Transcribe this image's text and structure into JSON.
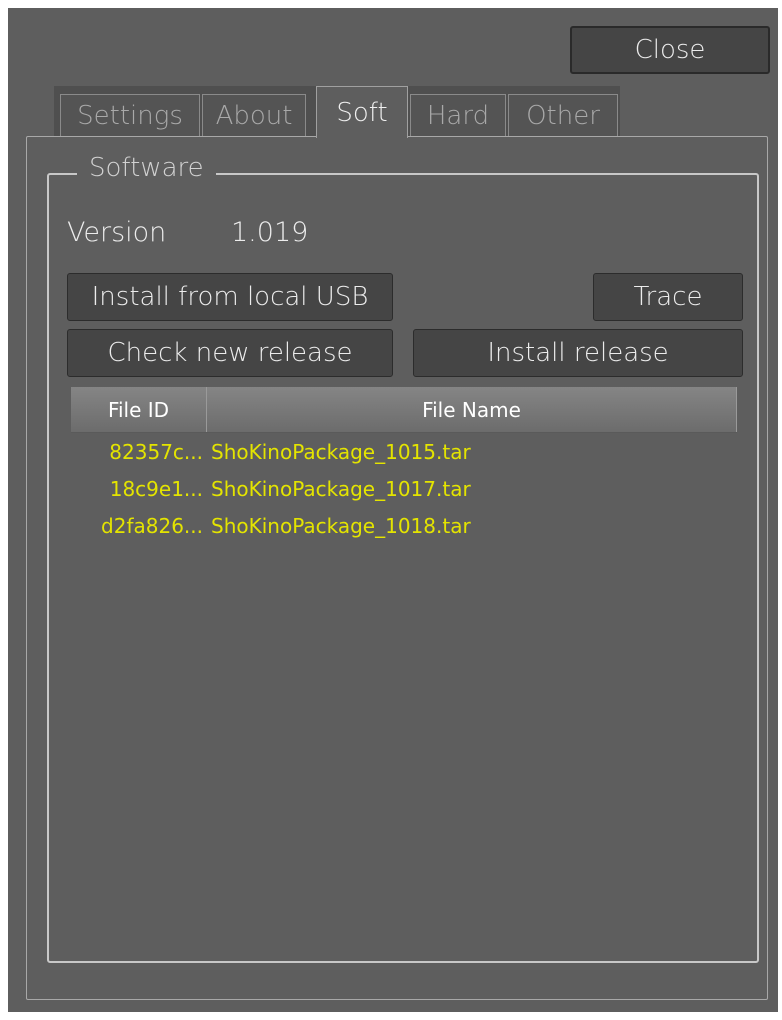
{
  "toolbar": {
    "close_label": "Close"
  },
  "tabs": [
    {
      "label": "Settings",
      "active": false
    },
    {
      "label": "About",
      "active": false
    },
    {
      "label": "Soft",
      "active": true
    },
    {
      "label": "Hard",
      "active": false
    },
    {
      "label": "Other",
      "active": false
    }
  ],
  "software": {
    "group_title": "Software",
    "version_label": "Version",
    "version_value": "1.019",
    "install_usb_label": "Install from local USB",
    "trace_label": "Trace",
    "check_release_label": "Check new release",
    "install_release_label": "Install release",
    "table": {
      "columns": [
        "File ID",
        "File Name"
      ],
      "rows": [
        {
          "file_id": "82357c...",
          "file_name": "ShoKinoPackage_1015.tar"
        },
        {
          "file_id": "18c9e1...",
          "file_name": "ShoKinoPackage_1017.tar"
        },
        {
          "file_id": "d2fa826...",
          "file_name": "ShoKinoPackage_1018.tar"
        }
      ]
    }
  },
  "colors": {
    "background": "#5e5e5e",
    "button": "#454545",
    "row_text": "#e4e400"
  }
}
